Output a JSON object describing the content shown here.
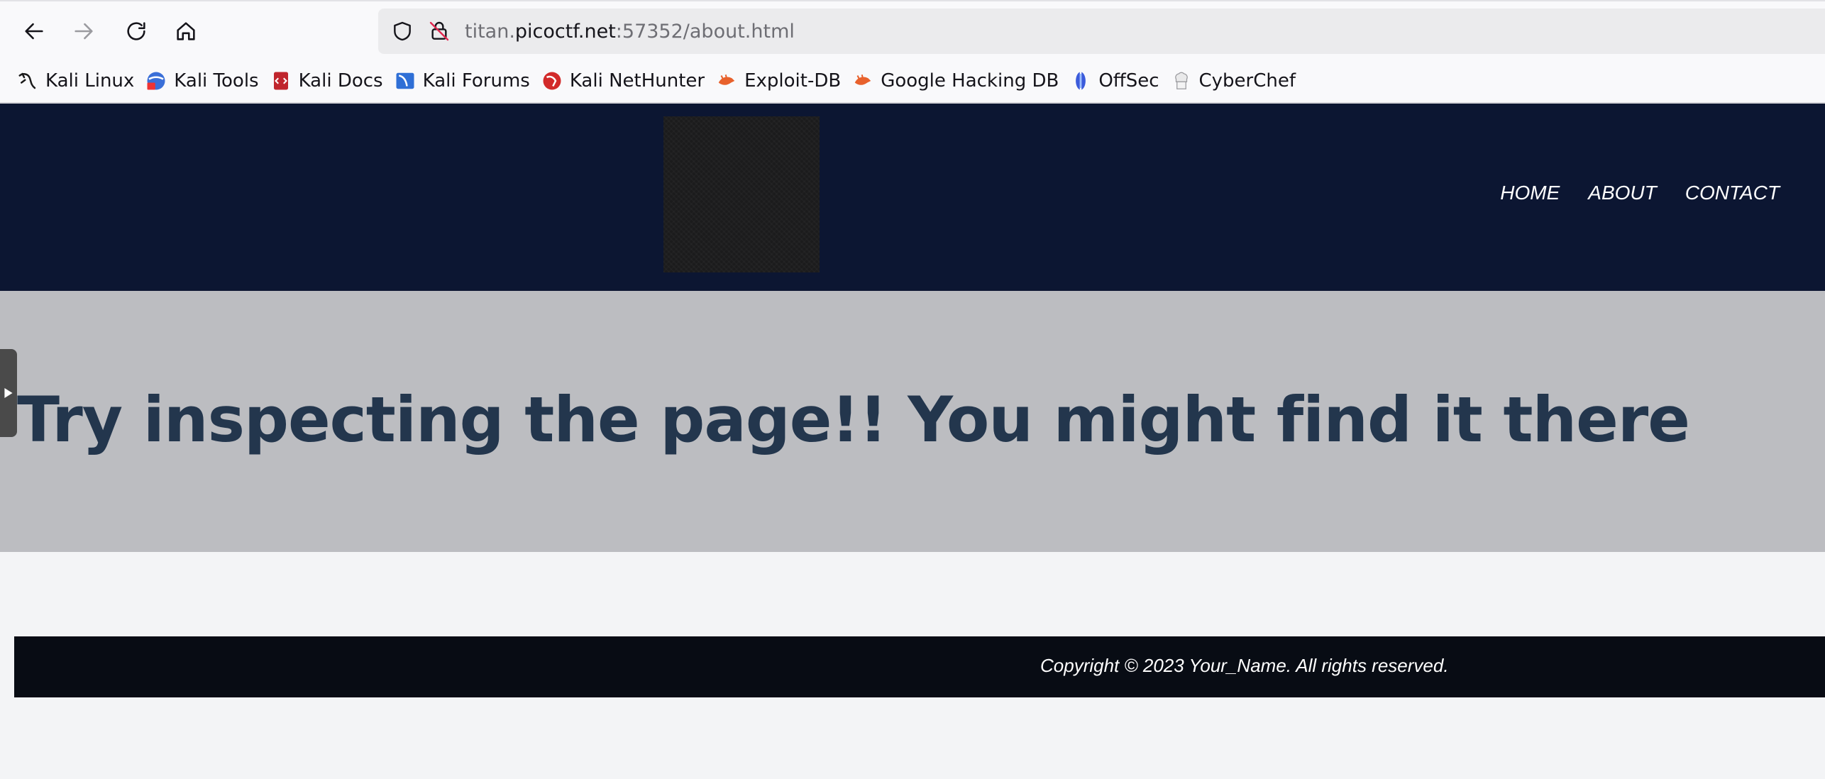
{
  "browser": {
    "url": {
      "prefix": "titan.",
      "host": "picoctf.net",
      "suffix": ":57352/about.html"
    },
    "buttons": {
      "back_icon": "arrow-left",
      "forward_icon": "arrow-right",
      "reload_icon": "reload",
      "home_icon": "home"
    }
  },
  "bookmarks": [
    {
      "label": "Kali Linux",
      "icon": "kali-dragon"
    },
    {
      "label": "Kali Tools",
      "icon": "kali-tools"
    },
    {
      "label": "Kali Docs",
      "icon": "kali-docs"
    },
    {
      "label": "Kali Forums",
      "icon": "kali-forums"
    },
    {
      "label": "Kali NetHunter",
      "icon": "kali-nethunter"
    },
    {
      "label": "Exploit-DB",
      "icon": "exploit-db"
    },
    {
      "label": "Google Hacking DB",
      "icon": "ghdb"
    },
    {
      "label": "OffSec",
      "icon": "offsec"
    },
    {
      "label": "CyberChef",
      "icon": "cyberchef"
    }
  ],
  "site": {
    "nav": [
      {
        "label": "HOME"
      },
      {
        "label": "ABOUT"
      },
      {
        "label": "CONTACT"
      }
    ],
    "hero_title": "Try inspecting the page!! You might find it there",
    "footer_text": "Copyright © 2023 Your_Name. All rights reserved."
  },
  "colors": {
    "header_bg": "#0c1632",
    "hero_bg": "#bcbdc1",
    "hero_text": "#23364d",
    "footer_bg": "#080c14",
    "page_bg": "#f3f4f6"
  }
}
